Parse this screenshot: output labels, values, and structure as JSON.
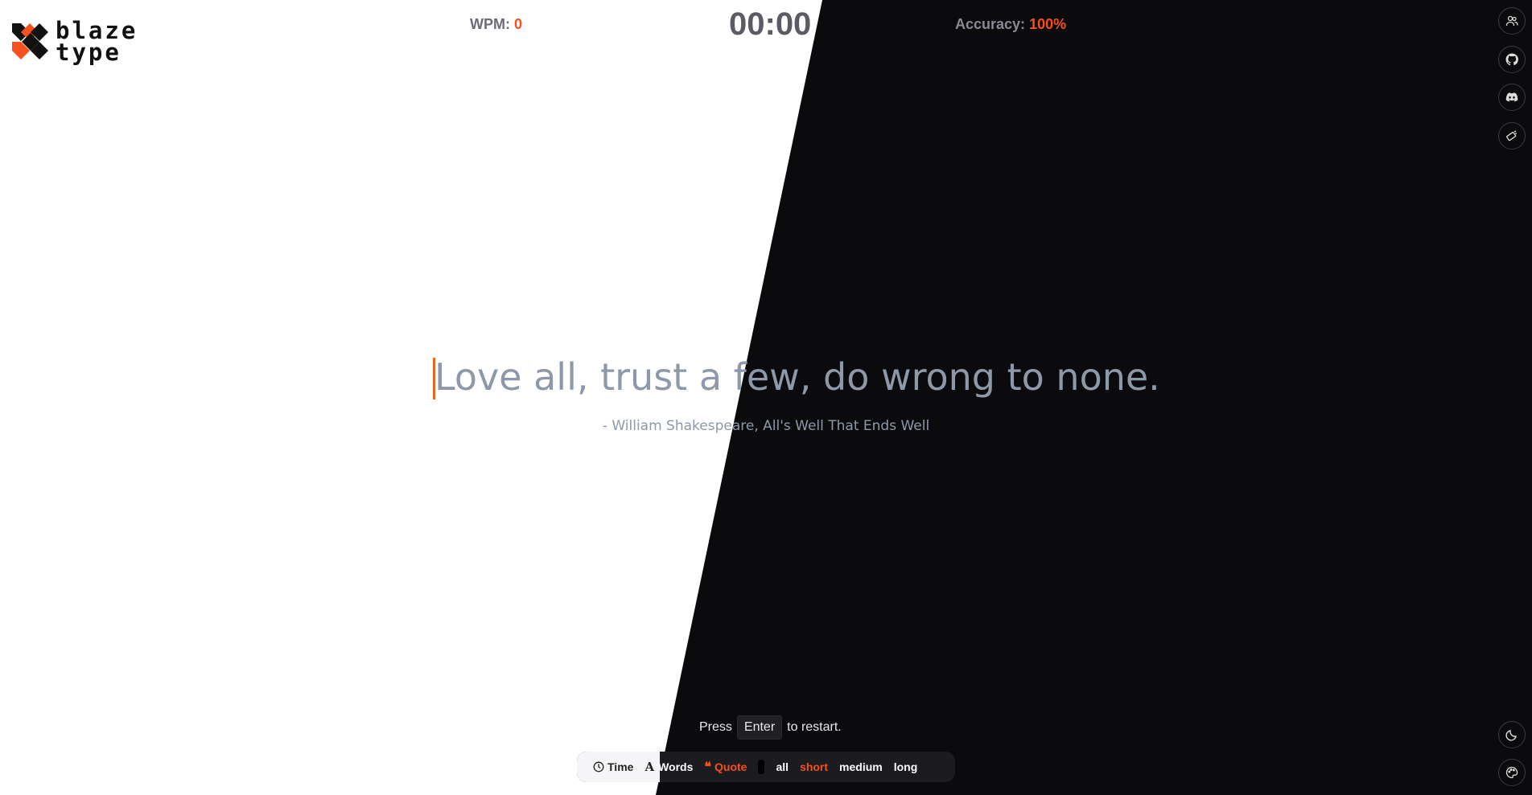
{
  "app": {
    "logo_line1": "blaze",
    "logo_line2": "type"
  },
  "stats": {
    "wpm_label": "WPM:",
    "wpm_value": "0",
    "timer": "00:00",
    "accuracy_label": "Accuracy:",
    "accuracy_value": "100%"
  },
  "quote": {
    "text": "Love all, trust a few, do wrong to none.",
    "author": "- William Shakespeare, All's Well That Ends Well"
  },
  "restart": {
    "prefix": "Press",
    "key": "Enter",
    "suffix": "to restart."
  },
  "modes": {
    "time_label": "Time",
    "words_label": "Words",
    "quote_label": "Quote",
    "lengths": [
      "all",
      "short",
      "medium",
      "long"
    ],
    "active_length": "short"
  },
  "sidebar_icons": [
    "users-icon",
    "github-icon",
    "discord-icon",
    "keyboard-icon"
  ],
  "bottom_icons": [
    "moon-icon",
    "palette-icon"
  ],
  "colors": {
    "accent": "#f4511e",
    "dark_bg": "#0b0b0d",
    "light_bg": "#ffffff",
    "caret": "#e8681d",
    "quote_text": "#8d98a8"
  }
}
